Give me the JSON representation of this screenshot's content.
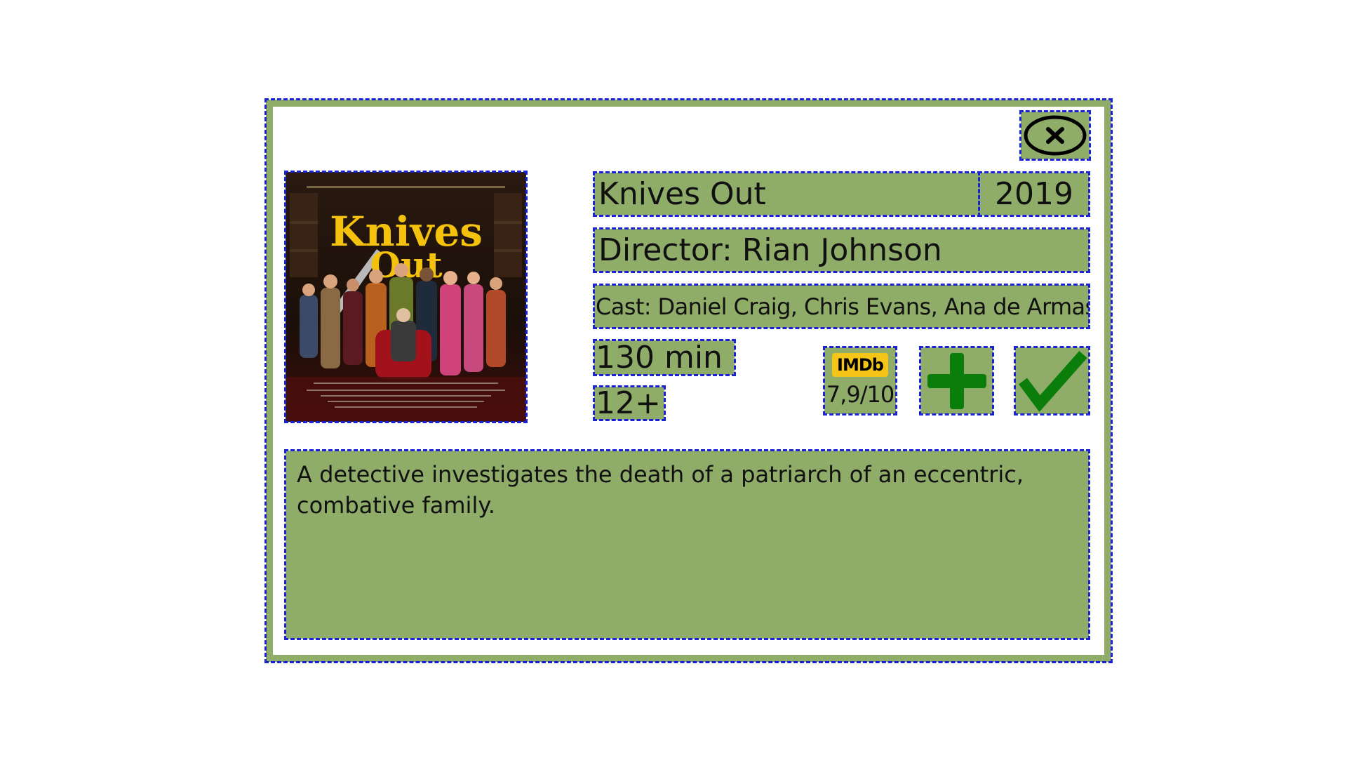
{
  "movie": {
    "title": "Knives Out",
    "year": "2019",
    "director": "Director: Rian Johnson",
    "cast": "Cast: Daniel Craig, Chris Evans, Ana de Armas",
    "runtime": "130 min",
    "age_rating": "12+",
    "imdb_label": "IMDb",
    "imdb_rating": "7,9/10",
    "description": "A detective investigates the death of a patriarch of an eccentric, combative family.",
    "poster_title_line1": "Knives",
    "poster_title_line2": "Out"
  },
  "icons": {
    "close": "close-x-circle-icon",
    "add": "plus-icon",
    "watched": "checkmark-icon"
  },
  "colors": {
    "panel": "#8fac69",
    "outline": "#1a22d8",
    "icon_green": "#0a7d0a",
    "imdb_yellow": "#f5c518",
    "poster_title": "#f4c20d"
  }
}
